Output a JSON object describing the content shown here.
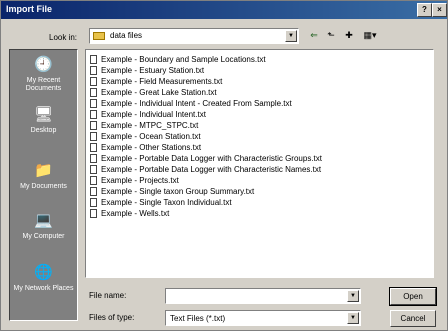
{
  "window": {
    "title": "Import File",
    "help": "?",
    "close": "×"
  },
  "toolbar": {
    "lookin_label": "Look in:",
    "lookin_value": "data files",
    "combo_arrow": "▼",
    "back": "⇐",
    "up": "⬑",
    "new_folder": "✚",
    "view": "▦▾"
  },
  "places": [
    {
      "label": "My Recent Documents",
      "icon": "🕘"
    },
    {
      "label": "Desktop",
      "icon": "🖥"
    },
    {
      "label": "My Documents",
      "icon": "📁"
    },
    {
      "label": "My Computer",
      "icon": "💻"
    },
    {
      "label": "My Network Places",
      "icon": "🌐"
    }
  ],
  "files": [
    "Example - Boundary and Sample Locations.txt",
    "Example - Estuary Station.txt",
    "Example - Field Measurements.txt",
    "Example - Great Lake Station.txt",
    "Example - Individual Intent - Created From Sample.txt",
    "Example - Individual Intent.txt",
    "Example - MTPC_STPC.txt",
    "Example - Ocean Station.txt",
    "Example - Other Stations.txt",
    "Example - Portable Data Logger with Characteristic Groups.txt",
    "Example - Portable Data Logger with Characteristic Names.txt",
    "Example - Projects.txt",
    "Example - Single taxon Group Summary.txt",
    "Example - Single Taxon Individual.txt",
    "Example - Wells.txt"
  ],
  "form": {
    "filename_label": "File name:",
    "filename_value": "",
    "filetype_label": "Files of type:",
    "filetype_value": "Text Files (*.txt)"
  },
  "buttons": {
    "open": "Open",
    "cancel": "Cancel"
  }
}
